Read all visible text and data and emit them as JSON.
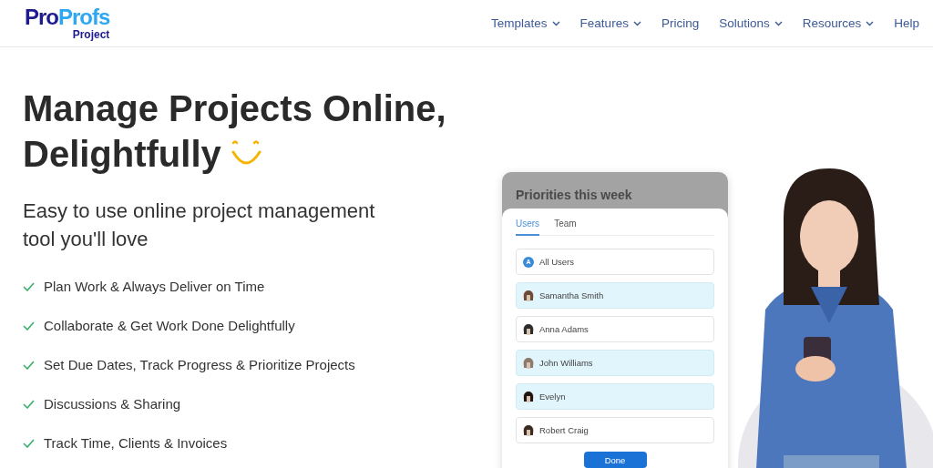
{
  "logo": {
    "brand_left": "Pro",
    "brand_right": "Profs",
    "product": "Project"
  },
  "nav": [
    {
      "label": "Templates",
      "dropdown": true
    },
    {
      "label": "Features",
      "dropdown": true
    },
    {
      "label": "Pricing",
      "dropdown": false
    },
    {
      "label": "Solutions",
      "dropdown": true
    },
    {
      "label": "Resources",
      "dropdown": true
    },
    {
      "label": "Help",
      "dropdown": false
    }
  ],
  "hero": {
    "title_line_1": "Manage Projects Online,",
    "title_line_2": "Delightfully",
    "subtitle": "Easy to use online project management tool you'll love",
    "features": [
      "Plan Work & Always Deliver on Time",
      "Collaborate & Get Work Done Delightfully",
      "Set Due Dates, Track Progress & Prioritize Projects",
      "Discussions & Sharing",
      "Track Time, Clients & Invoices"
    ]
  },
  "card": {
    "title": "Priorities this week",
    "tabs": [
      {
        "label": "Users",
        "selected": true
      },
      {
        "label": "Team",
        "selected": false
      }
    ],
    "users": [
      {
        "name": "All Users",
        "kind": "letter",
        "initial": "A",
        "selected": false
      },
      {
        "name": "Samantha Smith",
        "selected": true
      },
      {
        "name": "Anna Adams",
        "selected": false
      },
      {
        "name": "John Williams",
        "selected": true
      },
      {
        "name": "Evelyn",
        "selected": true
      },
      {
        "name": "Robert Craig",
        "selected": false
      }
    ],
    "button": "Done"
  }
}
